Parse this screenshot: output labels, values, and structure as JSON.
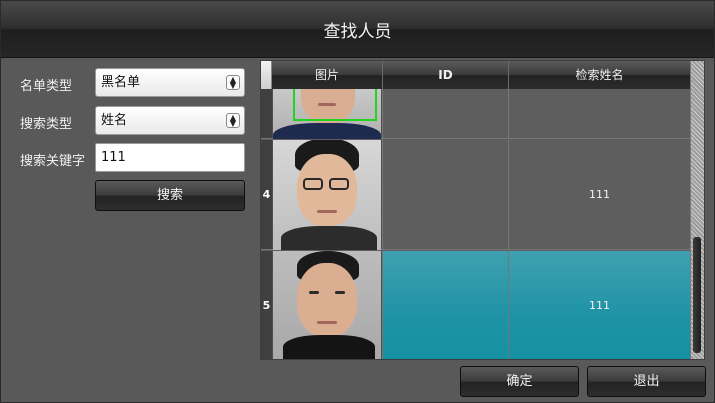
{
  "dialog": {
    "title": "查找人员"
  },
  "form": {
    "list_type_label": "名单类型",
    "list_type_value": "黑名单",
    "search_type_label": "搜索类型",
    "search_type_value": "姓名",
    "keyword_label": "搜索关键字",
    "keyword_value": "111",
    "search_button": "搜索"
  },
  "grid": {
    "columns": [
      "图片",
      "ID",
      "检索姓名"
    ],
    "rows": [
      {
        "num": "",
        "id": "",
        "name": ""
      },
      {
        "num": "4",
        "id": "",
        "name": "111"
      },
      {
        "num": "5",
        "id": "",
        "name": "111"
      }
    ],
    "selected_row": 2
  },
  "footer": {
    "ok_button": "确定",
    "exit_button": "退出"
  }
}
